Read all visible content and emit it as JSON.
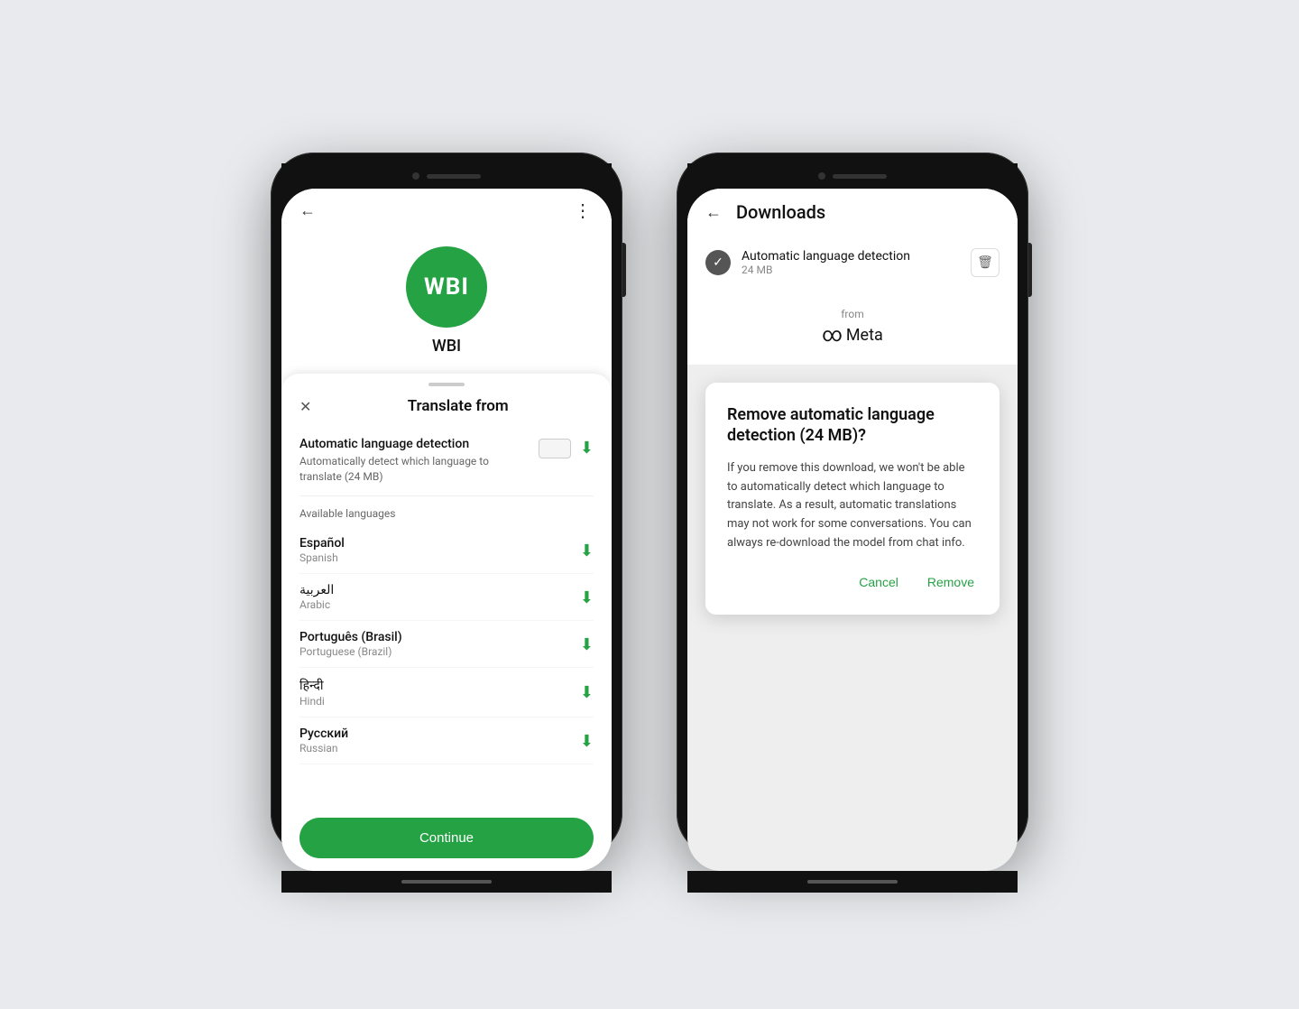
{
  "page": {
    "background": "#e8eaed"
  },
  "left_phone": {
    "app_name": "WBI",
    "logo_text": "WBI",
    "back_label": "←",
    "more_label": "⋮",
    "sheet": {
      "title": "Translate from",
      "close_label": "✕",
      "auto_detect": {
        "title": "Automatic language detection",
        "description": "Automatically detect which language to translate (24 MB)"
      },
      "section_label": "Available languages",
      "languages": [
        {
          "name": "Español",
          "subtitle": "Spanish"
        },
        {
          "name": "العربية",
          "subtitle": "Arabic"
        },
        {
          "name": "Português (Brasil)",
          "subtitle": "Portuguese (Brazil)"
        },
        {
          "name": "हिन्दी",
          "subtitle": "Hindi"
        },
        {
          "name": "Русский",
          "subtitle": "Russian"
        }
      ],
      "continue_button": "Continue"
    }
  },
  "right_phone": {
    "back_label": "←",
    "title": "Downloads",
    "download_item": {
      "name": "Automatic language detection",
      "size": "24 MB"
    },
    "from_label": "from",
    "meta_label": "Meta",
    "dialog": {
      "title": "Remove automatic language detection (24 MB)?",
      "body": "If you remove this download, we won't be able to automatically detect which language to translate. As a result, automatic translations may not work for some conversations. You can always re-download the model from chat info.",
      "cancel_label": "Cancel",
      "remove_label": "Remove"
    }
  }
}
